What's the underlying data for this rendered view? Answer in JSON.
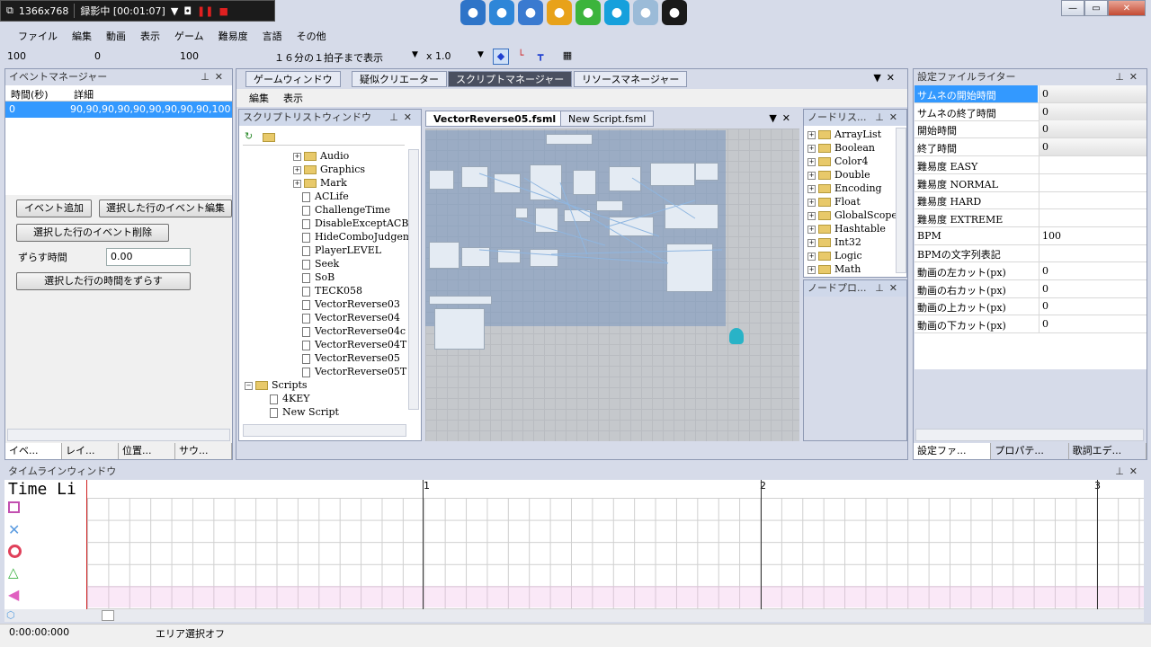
{
  "recorder": {
    "resolution": "1366x768",
    "status": "録影中 [00:01:07]"
  },
  "tray": [
    {
      "name": "refresh-blue-icon",
      "bg": "#2e74c8"
    },
    {
      "name": "sync-blue-icon",
      "bg": "#2e86d8"
    },
    {
      "name": "monitor-icon",
      "bg": "#3a7ad0"
    },
    {
      "name": "v-logo-icon",
      "bg": "#e8a21a"
    },
    {
      "name": "line-icon",
      "bg": "#3cb43c"
    },
    {
      "name": "skype-icon",
      "bg": "#16a0dc"
    },
    {
      "name": "mail-icon",
      "bg": "#9bbbd8"
    },
    {
      "name": "record-icon",
      "bg": "#1a1a1a"
    }
  ],
  "menu": [
    "ファイル",
    "編集",
    "動画",
    "表示",
    "ゲーム",
    "難易度",
    "言語",
    "その他"
  ],
  "toolbar": {
    "v1": "100",
    "v2": "0",
    "v3": "100",
    "beat": "１６分の１拍子まで表示",
    "zoom": "x 1.0"
  },
  "eventManager": {
    "title": "イベントマネージャー",
    "colTime": "時間(秒)",
    "colDetail": "詳細",
    "row": {
      "time": "0",
      "detail": "90,90,90,90,90,90,90,90,90,100,"
    },
    "addBtn": "イベント追加",
    "editBtn": "選択した行のイベント編集",
    "delBtn": "選択した行のイベント削除",
    "shiftLabel": "ずらす時間",
    "shiftValue": "0.00",
    "shiftBtn": "選択した行の時間をずらす",
    "tabs": [
      "イベ...",
      "レイ...",
      "位置...",
      "サウ..."
    ]
  },
  "center": {
    "tabs": [
      "ゲームウィンドウ",
      "疑似クリエーター",
      "スクリプトマネージャー",
      "リソースマネージャー"
    ],
    "submenu": [
      "編集",
      "表示"
    ]
  },
  "scriptList": {
    "title": "スクリプトリストウィンドウ",
    "folders": [
      "Audio",
      "Graphics",
      "Mark"
    ],
    "files": [
      "ACLife",
      "ChallengeTime",
      "DisableExceptACBu",
      "HideComboJudgeme",
      "PlayerLEVEL",
      "Seek",
      "SoB",
      "TECK058",
      "VectorReverse03",
      "VectorReverse04",
      "VectorReverse04c",
      "VectorReverse04T",
      "VectorReverse05",
      "VectorReverse05T"
    ],
    "scripts": "Scripts",
    "scriptItems": [
      "4KEY",
      "New Script"
    ]
  },
  "editor": {
    "tabs": [
      "VectorReverse05.fsml",
      "New Script.fsml"
    ]
  },
  "nodeList": {
    "title": "ノードリス...",
    "items": [
      "ArrayList",
      "Boolean",
      "Color4",
      "Double",
      "Encoding",
      "Float",
      "GlobalScope",
      "Hashtable",
      "Int32",
      "Logic",
      "Math"
    ]
  },
  "nodeProp": {
    "title": "ノードプロ..."
  },
  "settings": {
    "title": "設定ファイルライター",
    "rows": [
      {
        "k": "サムネの開始時間",
        "v": "0"
      },
      {
        "k": "サムネの終了時間",
        "v": "0"
      },
      {
        "k": "開始時間",
        "v": "0"
      },
      {
        "k": "終了時間",
        "v": "0"
      },
      {
        "k": "難易度 EASY",
        "v": ""
      },
      {
        "k": "難易度 NORMAL",
        "v": ""
      },
      {
        "k": "難易度 HARD",
        "v": ""
      },
      {
        "k": "難易度 EXTREME",
        "v": ""
      },
      {
        "k": "BPM",
        "v": "100"
      },
      {
        "k": "BPMの文字列表記",
        "v": ""
      },
      {
        "k": "動画の左カット(px)",
        "v": "0"
      },
      {
        "k": "動画の右カット(px)",
        "v": "0"
      },
      {
        "k": "動画の上カット(px)",
        "v": "0"
      },
      {
        "k": "動画の下カット(px)",
        "v": "0"
      }
    ],
    "tabs": [
      "設定ファ...",
      "プロパテ...",
      "歌詞エデ..."
    ]
  },
  "timeline": {
    "title": "タイムラインウィンドウ",
    "label": "Time Li",
    "markers": [
      "1",
      "2",
      "3"
    ],
    "time": "0:00:00:000",
    "area": "エリア選択オフ"
  }
}
